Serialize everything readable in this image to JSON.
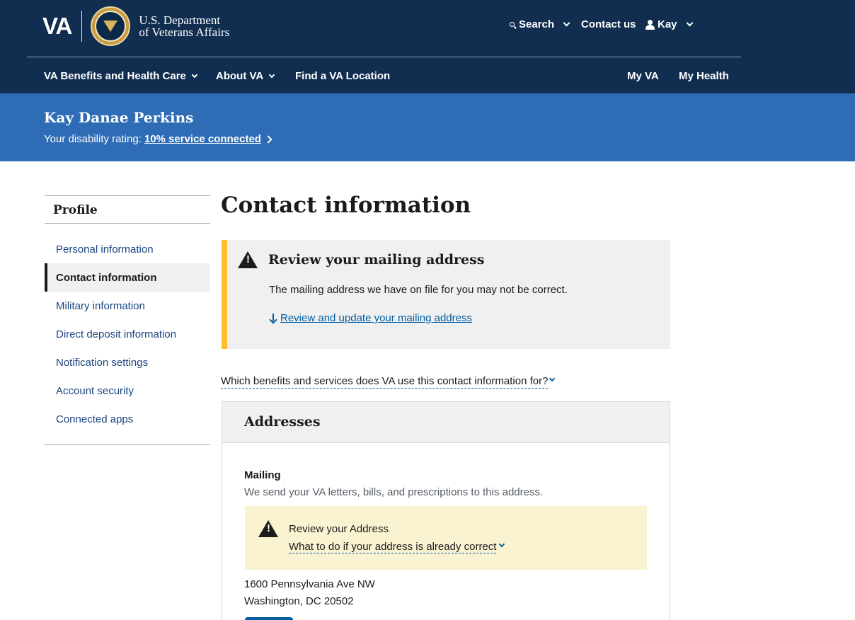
{
  "header": {
    "logo_mark": "VA",
    "dept_line1": "U.S. Department",
    "dept_line2": "of Veterans Affairs",
    "search_label": "Search",
    "contact_label": "Contact us",
    "user_label": "Kay",
    "nav": {
      "benefits": "VA Benefits and Health Care",
      "about": "About VA",
      "find_location": "Find a VA Location",
      "my_va": "My VA",
      "my_health": "My Health"
    }
  },
  "hero": {
    "name": "Kay Danae Perkins",
    "rating_prefix": "Your disability rating:",
    "rating_link": "10% service connected"
  },
  "sidebar": {
    "title": "Profile",
    "items": [
      {
        "label": "Personal information"
      },
      {
        "label": "Contact information",
        "active": true
      },
      {
        "label": "Military information"
      },
      {
        "label": "Direct deposit information"
      },
      {
        "label": "Notification settings"
      },
      {
        "label": "Account security"
      },
      {
        "label": "Connected apps"
      }
    ]
  },
  "main": {
    "title": "Contact information",
    "alert": {
      "title": "Review your mailing address",
      "body": "The mailing address we have on file for you may not be correct.",
      "link": "Review and update your mailing address"
    },
    "which_link": "Which benefits and services does VA use this contact information for?",
    "addresses": {
      "title": "Addresses",
      "mailing_label": "Mailing",
      "mailing_desc": "We send your VA letters, bills, and prescriptions to this address.",
      "slim_alert": {
        "title": "Review your Address",
        "link": "What to do if your address is already correct"
      },
      "address_line1": "1600 Pennsylvania Ave NW",
      "address_line2": "Washington, DC 20502"
    }
  },
  "colors": {
    "header_bg": "#112e51",
    "hero_bg": "#2e6cb6",
    "warning_border": "#ffbe2e",
    "link": "#005ea2"
  }
}
